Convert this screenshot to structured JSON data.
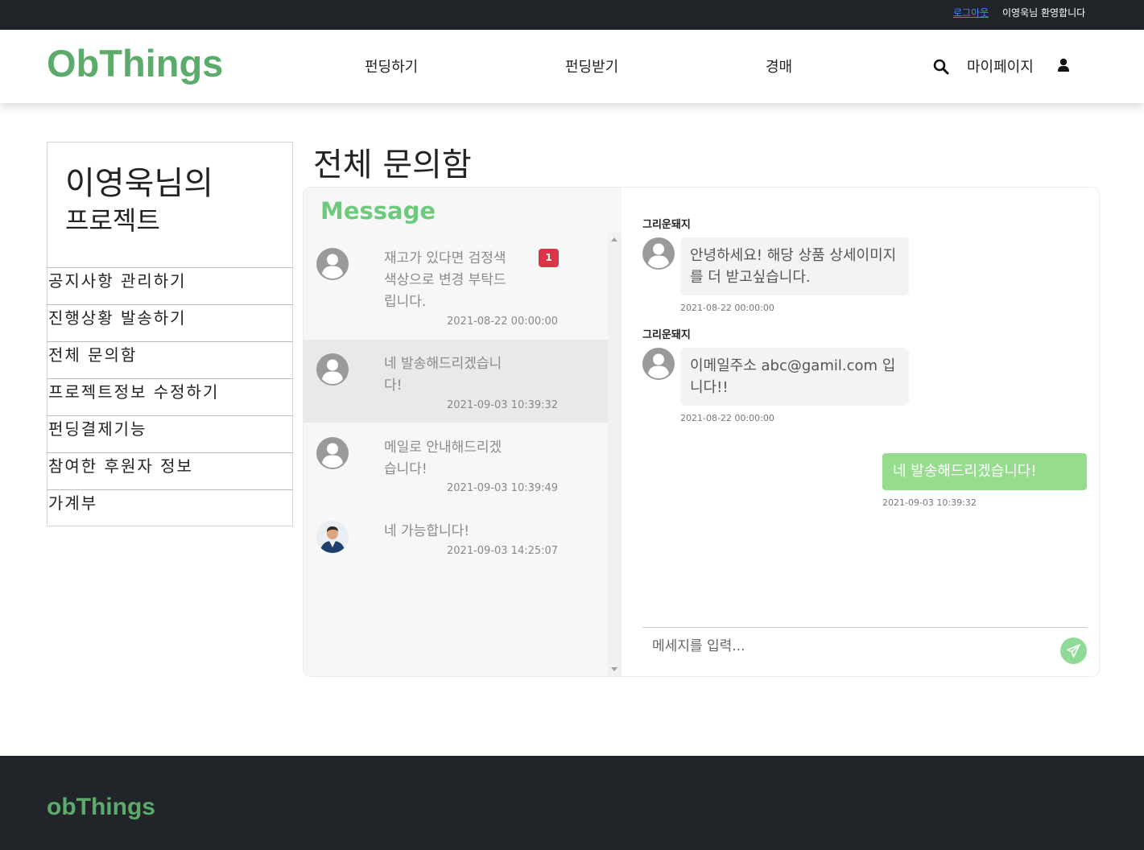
{
  "topbar": {
    "logout_label": "로그아웃",
    "welcome_text": "이영욱님 환영합니다"
  },
  "header": {
    "logo": "ObThings",
    "nav": [
      "펀딩하기",
      "펀딩받기",
      "경매"
    ],
    "mypage_label": "마이페이지",
    "icons": {
      "search": "search-icon",
      "user": "user-icon"
    }
  },
  "sidebar": {
    "title_line1": "이영욱님의",
    "title_line2": "프로젝트",
    "items": [
      "공지사항 관리하기",
      "진행상황 발송하기",
      "전체 문의함",
      "프로젝트정보 수정하기",
      "펀딩결제기능",
      "참여한 후원자 정보",
      "가계부"
    ]
  },
  "page_title": "전체 문의함",
  "conversations": {
    "heading": "Message",
    "items": [
      {
        "text": "재고가 있다면 검정색 색상으로 변경 부탁드립니다.",
        "time": "2021-08-22 00:00:00",
        "badge": "1",
        "avatar": "default-avatar"
      },
      {
        "text": "네 발송해드리겠습니다!",
        "time": "2021-09-03 10:39:32",
        "avatar": "default-avatar"
      },
      {
        "text": "메일로 안내해드리겠습니다!",
        "time": "2021-09-03 10:39:49",
        "avatar": "default-avatar"
      },
      {
        "text": "네 가능합니다!",
        "time": "2021-09-03 14:25:07",
        "avatar": "photo-avatar"
      }
    ]
  },
  "chat": {
    "messages": [
      {
        "direction": "incoming",
        "sender": "그리운돼지",
        "text": "안녕하세요! 해당 상품 상세이미지를 더 받고싶습니다.",
        "time": "2021-08-22 00:00:00"
      },
      {
        "direction": "incoming",
        "sender": "그리운돼지",
        "text": "이메일주소 abc@gamil.com 입니다!!",
        "time": "2021-08-22 00:00:00"
      },
      {
        "direction": "outgoing",
        "text": "네 발송해드리겠습니다!",
        "time": "2021-09-03 10:39:32"
      }
    ],
    "input_placeholder": "메세지를 입력...",
    "send_icon": "paper-plane-icon"
  },
  "footer": {
    "logo": "obThings"
  },
  "colors": {
    "brand_green": "#5bab6b",
    "message_heading": "#6bcb7b",
    "outgoing_bubble": "#95dd8d",
    "dark_bar": "#212529",
    "badge": "#dc3545"
  }
}
